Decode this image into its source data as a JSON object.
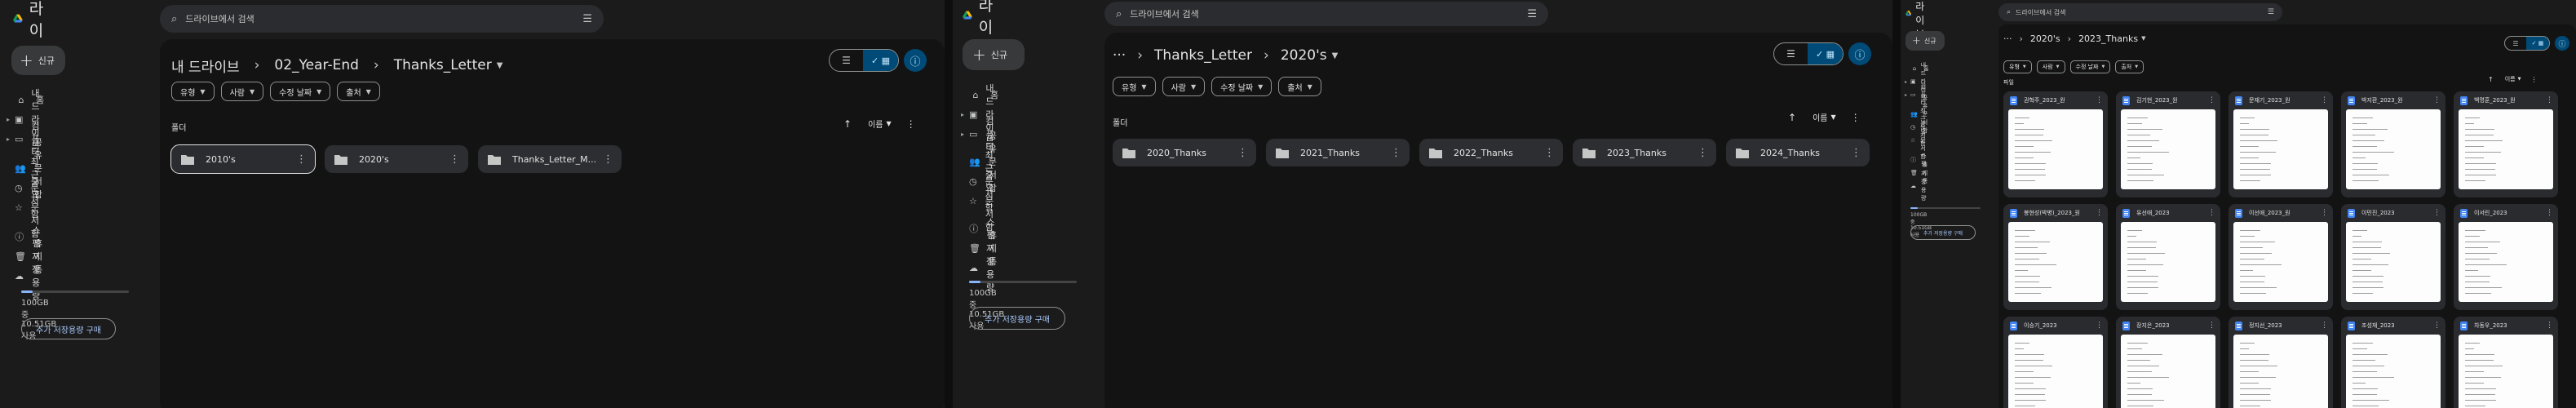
{
  "app": {
    "name": "드라이브"
  },
  "search": {
    "placeholder": "드라이브에서 검색"
  },
  "sidebar": {
    "new_label": "신규",
    "items": [
      {
        "label": "홈",
        "icon": "home-icon"
      },
      {
        "label": "내 드라이브",
        "icon": "my-drive-icon"
      },
      {
        "label": "컴퓨터",
        "icon": "computer-icon"
      },
      {
        "label": "공유 문서함",
        "icon": "shared-icon"
      },
      {
        "label": "최근 문서함",
        "icon": "recent-icon"
      },
      {
        "label": "중요 문서함",
        "icon": "star-icon"
      },
      {
        "label": "스팸",
        "icon": "spam-icon"
      },
      {
        "label": "휴지통",
        "icon": "trash-icon"
      },
      {
        "label": "저장용량",
        "icon": "cloud-icon"
      }
    ],
    "storage_text": "100GB 중 10.51GB 사용",
    "storage_used_fraction": 0.1051,
    "buy_label": "추가 저장용량 구매"
  },
  "filters": [
    "유형",
    "사람",
    "수정 날짜",
    "출처"
  ],
  "sort": {
    "label": "이름"
  },
  "panel1": {
    "breadcrumbs": [
      "내 드라이브",
      "02_Year-End",
      "Thanks_Letter"
    ],
    "section": "폴더",
    "folders": [
      "2010's",
      "2020's",
      "Thanks_Letter_M..."
    ]
  },
  "panel2": {
    "breadcrumbs": [
      "···",
      "Thanks_Letter",
      "2020's"
    ],
    "section": "폴더",
    "folders": [
      "2020_Thanks",
      "2021_Thanks",
      "2022_Thanks",
      "2023_Thanks",
      "2024_Thanks"
    ]
  },
  "panel3": {
    "breadcrumbs": [
      "···",
      "2020's",
      "2023_Thanks"
    ],
    "section": "파일",
    "files": [
      "권혁주_2023_원",
      "김기현_2023_원",
      "문재기_2023_원",
      "박지환_2023_원",
      "백명훈_2023_원",
      "봉현성(박병)_2023_원",
      "유선애_2023",
      "이선애_2023_원",
      "이민진_2023",
      "이서린_2023",
      "이승기_2023",
      "장지은_2023",
      "정지선_2023",
      "조성재_2023",
      "차동우_2023"
    ]
  },
  "colors": {
    "accent": "#8ab4f8",
    "selected": "#004a77",
    "background": "#1b1b1b",
    "surface": "#131314"
  }
}
